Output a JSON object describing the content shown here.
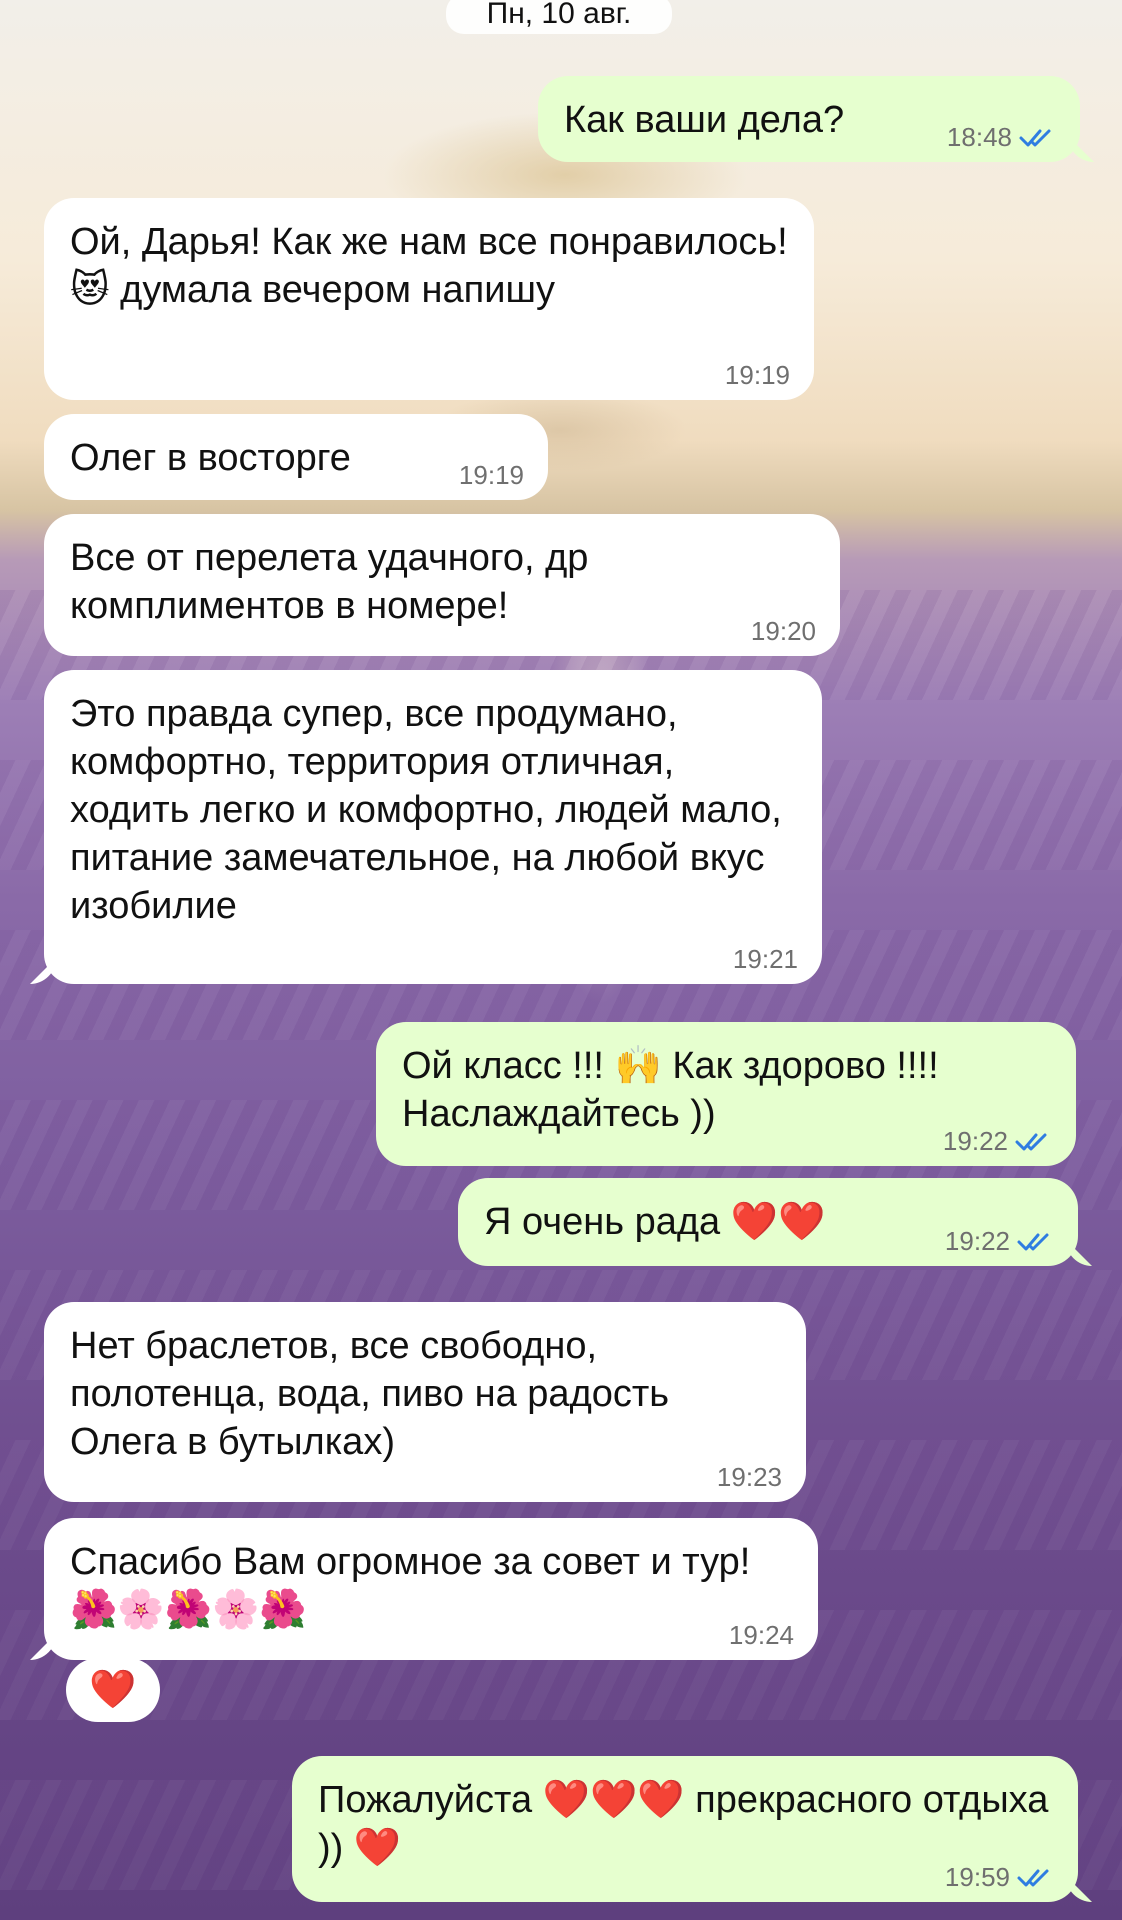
{
  "date_label": "Пн, 10 авг.",
  "messages": [
    {
      "id": "m1",
      "direction": "out",
      "text": "Как ваши дела?",
      "time": "18:48",
      "read": true
    },
    {
      "id": "m2",
      "direction": "in",
      "text": "Ой, Дарья! Как же нам все понравилось! 😻 думала вечером напишу",
      "time": "19:19"
    },
    {
      "id": "m3",
      "direction": "in",
      "text": "Олег в восторге",
      "time": "19:19"
    },
    {
      "id": "m4",
      "direction": "in",
      "text": "Все от перелета удачного, др комплиментов в номере!",
      "time": "19:20"
    },
    {
      "id": "m5",
      "direction": "in",
      "text": "Это правда супер, все продумано, комфортно, территория отличная, ходить легко и комфортно, людей мало, питание замечательное, на любой вкус изобилие",
      "time": "19:21"
    },
    {
      "id": "m6",
      "direction": "out",
      "text": "Ой класс !!! 🙌 Как здорово !!!! Наслаждайтесь ))",
      "time": "19:22",
      "read": true
    },
    {
      "id": "m7",
      "direction": "out",
      "text": "Я очень рада ❤️❤️",
      "time": "19:22",
      "read": true
    },
    {
      "id": "m8",
      "direction": "in",
      "text": "Нет браслетов, все свободно, полотенца, вода, пиво на радость Олега в бутылках)",
      "time": "19:23"
    },
    {
      "id": "m9",
      "direction": "in",
      "text": "Спасибо Вам огромное за совет и тур!🌺🌸🌺🌸🌺",
      "time": "19:24",
      "reaction": "❤️"
    },
    {
      "id": "m10",
      "direction": "out",
      "text": "Пожалуйста ❤️❤️❤️ прекрасного отдыха )) ❤️",
      "time": "19:59",
      "read": true
    }
  ],
  "colors": {
    "incoming_bubble": "#ffffff",
    "outgoing_bubble": "#e6ffcf",
    "read_check": "#2f7de1",
    "time_text": "#6f6f6f"
  },
  "icons": {
    "read": "double-check-icon"
  }
}
